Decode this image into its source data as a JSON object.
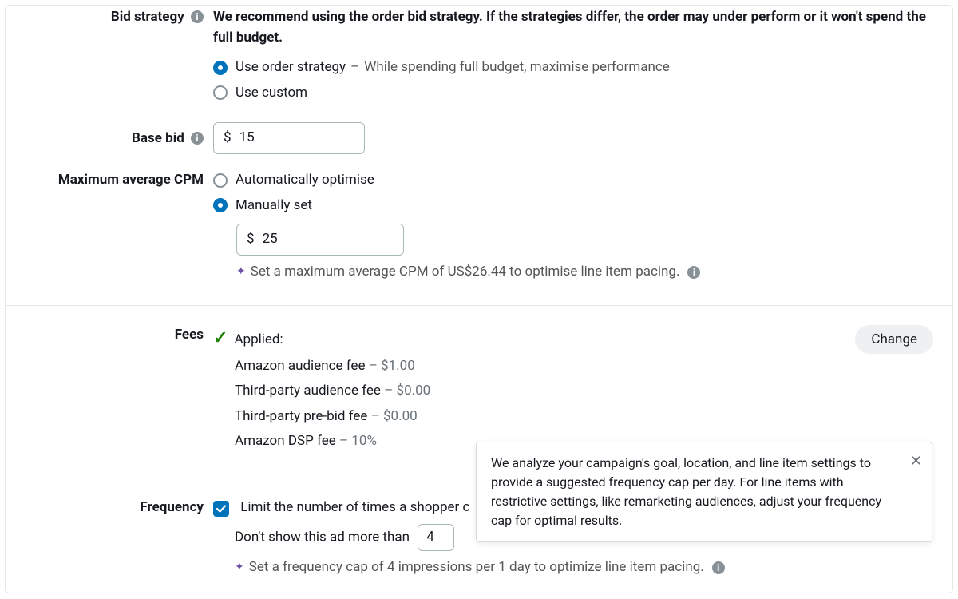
{
  "labels": {
    "bid_strategy": "Bid strategy",
    "base_bid": "Base bid",
    "max_avg_cpm": "Maximum average CPM",
    "fees": "Fees",
    "frequency": "Frequency"
  },
  "bid_strategy": {
    "note": "We recommend using the order bid strategy. If the strategies differ, the order may under perform or it won't spend the full budget.",
    "options": {
      "order": {
        "label": "Use order strategy",
        "suffix": "While spending full budget, maximise performance",
        "selected": true
      },
      "custom": {
        "label": "Use custom",
        "selected": false
      }
    }
  },
  "base_bid": {
    "currency": "$",
    "value": "15"
  },
  "max_avg_cpm": {
    "options": {
      "auto": {
        "label": "Automatically optimise",
        "selected": false
      },
      "manual": {
        "label": "Manually set",
        "selected": true
      }
    },
    "currency": "$",
    "value": "25",
    "suggestion": "Set a maximum average CPM of US$26.44 to optimise line item pacing."
  },
  "fees": {
    "applied_label": "Applied:",
    "change_label": "Change",
    "items": [
      {
        "label": "Amazon audience fee",
        "value": "$1.00"
      },
      {
        "label": "Third-party audience fee",
        "value": "$0.00"
      },
      {
        "label": "Third-party pre-bid fee",
        "value": "$0.00"
      },
      {
        "label": "Amazon DSP fee",
        "value": "10%"
      }
    ]
  },
  "frequency": {
    "checkbox_label": "Limit the number of times a shopper c",
    "dont_show_prefix": "Don't show this ad more than",
    "cap_value": "4",
    "suggestion": "Set a frequency cap of 4 impressions per 1 day to optimize line item pacing."
  },
  "tooltip": {
    "text": "We analyze your campaign's goal, location, and line item settings to provide a suggested frequency cap per day. For line items with restrictive settings, like remarketing audiences, adjust your frequency cap for optimal results."
  }
}
